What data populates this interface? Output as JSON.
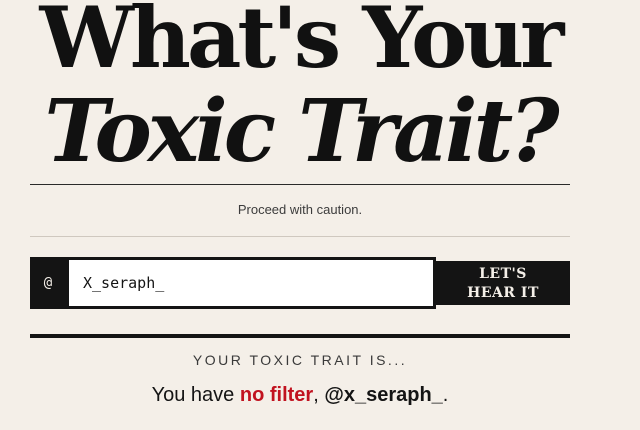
{
  "header": {
    "title_line_1": "What's Your",
    "title_line_2": "Toxic Trait?"
  },
  "tagline": "Proceed with caution.",
  "form": {
    "prefix": "@",
    "handle_value": "X_seraph_",
    "submit_line_1": "LET'S",
    "submit_line_2": "HEAR IT"
  },
  "result": {
    "label": "YOUR TOXIC TRAIT IS...",
    "prefix": "You have ",
    "trait": "no filter",
    "separator": ", ",
    "handle": "@x_seraph_",
    "suffix": "."
  },
  "colors": {
    "background": "#f4efe8",
    "ink": "#141414",
    "accent": "#c1121f"
  }
}
